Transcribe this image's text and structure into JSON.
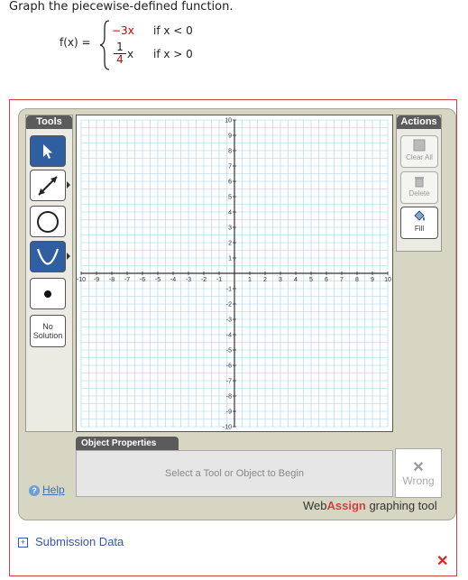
{
  "question": "Graph the piecewise-defined function.",
  "function": {
    "name": "f(x) =",
    "case1_expr": "−3x",
    "case1_cond": "if  x < 0",
    "case2_num": "1",
    "case2_den": "4",
    "case2_var": "x",
    "case2_cond": "if  x > 0"
  },
  "tools": {
    "label": "Tools",
    "no_solution_line1": "No",
    "no_solution_line2": "Solution"
  },
  "actions": {
    "label": "Actions",
    "clear_all": "Clear All",
    "delete": "Delete",
    "fill": "Fill"
  },
  "graph": {
    "x_min": -10,
    "x_max": 10,
    "y_min": -10,
    "y_max": 10,
    "grid_step": 0.5,
    "x_ticks": [
      "-10",
      "-9",
      "-8",
      "-7",
      "-6",
      "-5",
      "-4",
      "-3",
      "-2",
      "-1",
      "1",
      "2",
      "3",
      "4",
      "5",
      "6",
      "7",
      "8",
      "9",
      "10"
    ],
    "y_ticks": [
      "10",
      "9",
      "8",
      "7",
      "6",
      "5",
      "4",
      "3",
      "2",
      "1",
      "-1",
      "-2",
      "-3",
      "-4",
      "-5",
      "-6",
      "-7",
      "-8",
      "-9",
      "-10"
    ],
    "grid_color": "#9fd6ef",
    "axis_color": "#333333"
  },
  "object_properties": {
    "tab": "Object Properties",
    "hint": "Select a Tool or Object to Begin"
  },
  "status": {
    "wrong_label": "Wrong"
  },
  "help": "Help",
  "brand": {
    "web": "Web",
    "assign": "Assign",
    "suffix": " graphing tool"
  },
  "submission_data": "Submission Data"
}
